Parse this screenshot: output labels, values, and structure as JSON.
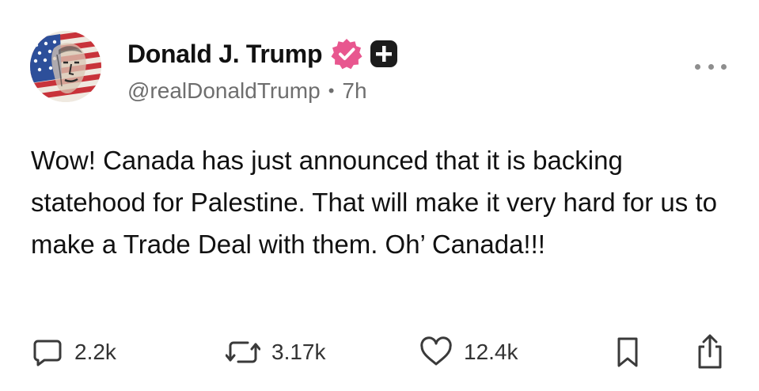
{
  "post": {
    "author": {
      "display_name": "Donald J. Trump",
      "handle": "@realDonaldTrump",
      "separator": "•",
      "time_ago": "7h",
      "verified_badge_color": "#e8578f",
      "plus_badge_color": "#1c1c1c"
    },
    "body": "Wow! Canada has just announced that it is backing statehood for Palestine. That will make it very hard for us to make a Trade Deal with them. Oh’ Canada!!!",
    "actions": {
      "replies": "2.2k",
      "reposts": "3.17k",
      "likes": "12.4k"
    },
    "icons": {
      "reply": "speech-bubble-icon",
      "repost": "repost-arrows-icon",
      "like": "heart-icon",
      "bookmark": "bookmark-icon",
      "share": "share-icon",
      "more": "more-dots-icon"
    },
    "colors": {
      "text": "#111111",
      "muted": "#6e6e6e",
      "icon": "#3a3a3a"
    }
  }
}
